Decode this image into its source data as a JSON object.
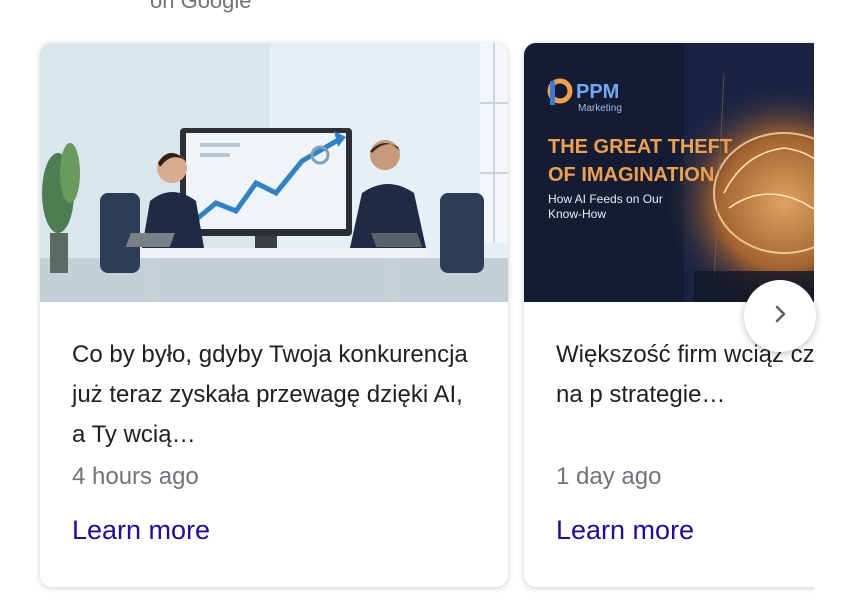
{
  "header": {
    "caption": "on Google"
  },
  "cards": [
    {
      "text": "Co by było, gdyby Twoja konkurencja już teraz zyskała przewagę dzięki AI, a Ty wcią…",
      "time": "4 hours ago",
      "link": "Learn more"
    },
    {
      "text": "Większość firm wciąż czas i pieniądze na p strategie…",
      "time": "1 day ago",
      "link": "Learn more",
      "image_text": {
        "brand": "PPM",
        "brand_sub": "Marketing",
        "headline_1": "THE GREAT THEFT",
        "headline_2": "OF IMAGINATION",
        "sub_1": "How AI Feeds on Our",
        "sub_2": "Know-How"
      }
    }
  ],
  "colors": {
    "link": "#1a0dab",
    "meta": "#70757a",
    "text": "#202124",
    "accent_orange": "#f0a04b"
  },
  "icons": {
    "next": "chevron-right-icon"
  }
}
